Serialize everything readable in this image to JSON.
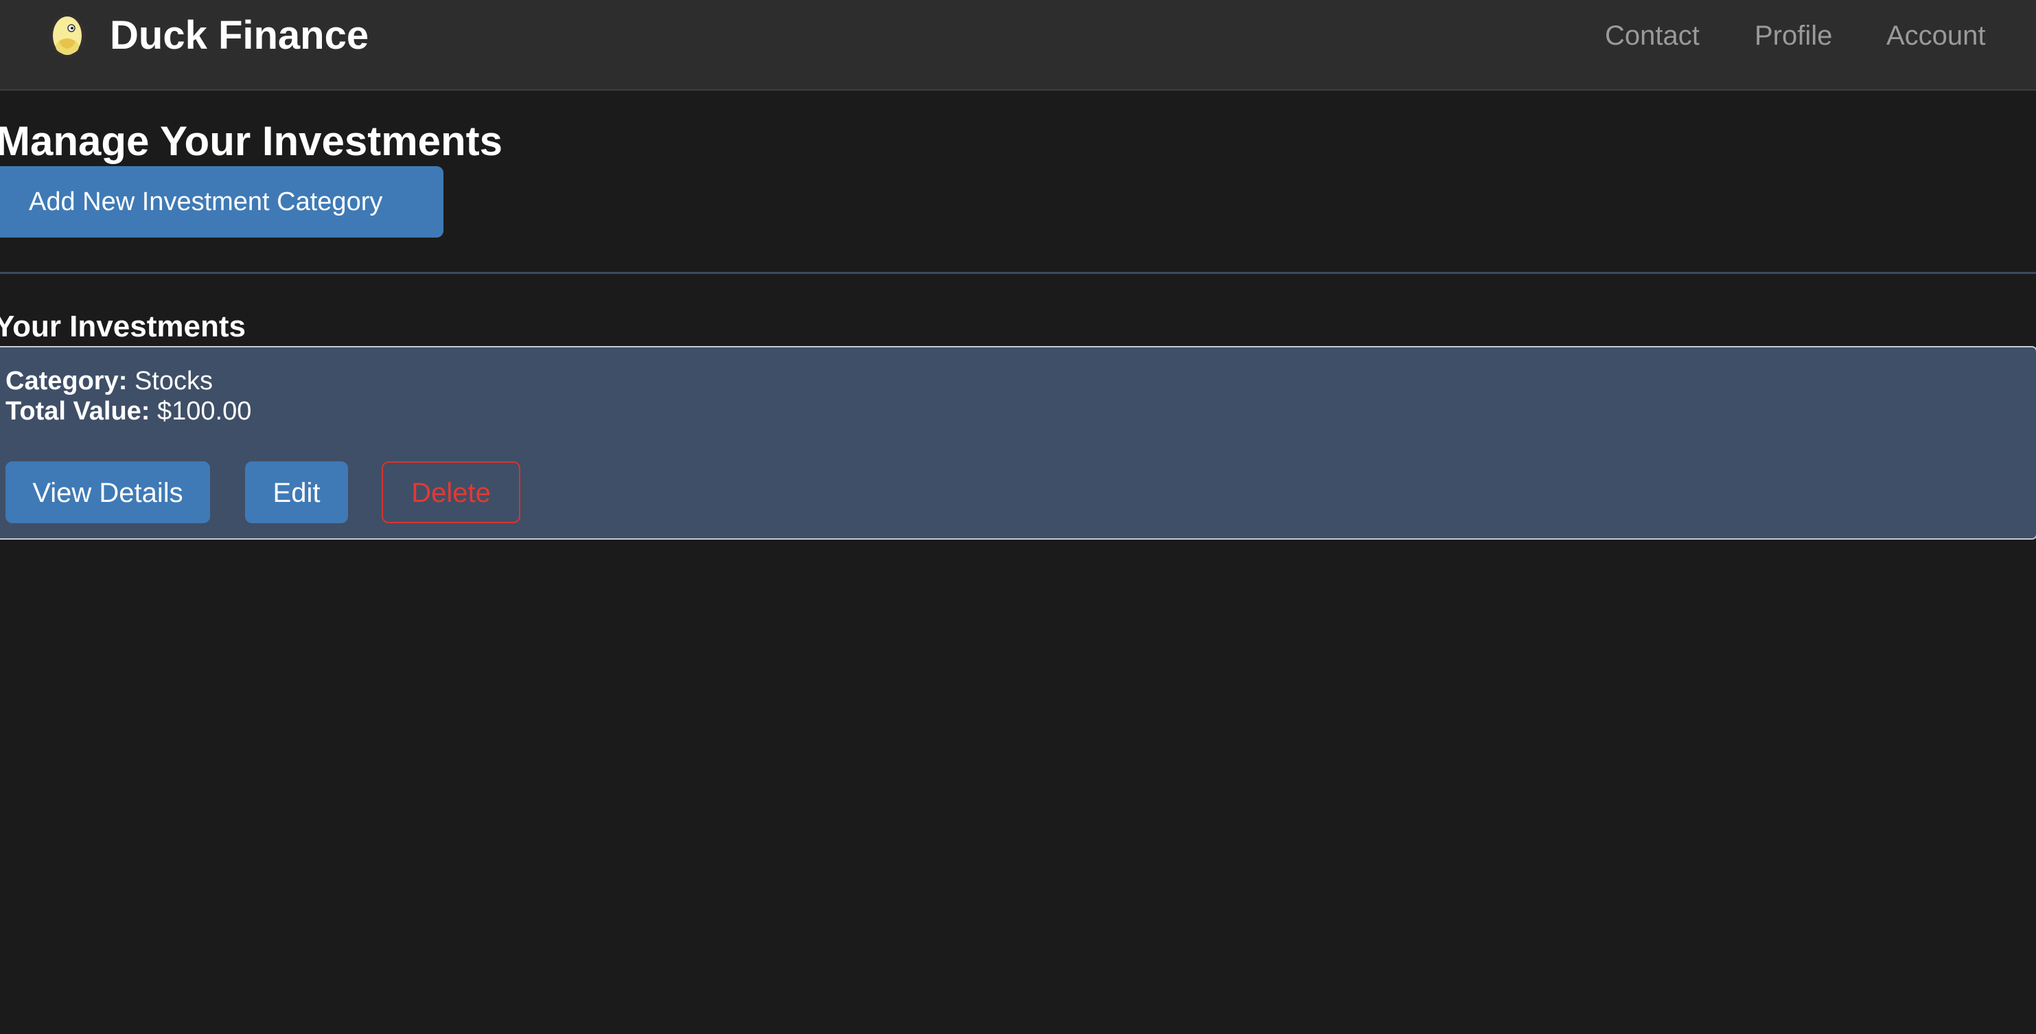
{
  "header": {
    "brand": "Duck Finance",
    "logo_icon": "duck-icon",
    "nav": {
      "contact": "Contact",
      "profile": "Profile",
      "account": "Account"
    }
  },
  "manage": {
    "title": "Manage Your Investments",
    "add_button_label": "Add New Investment Category"
  },
  "investments": {
    "title": "Your Investments",
    "items": [
      {
        "category_label": "Category:",
        "category_value": "Stocks",
        "total_label": "Total Value:",
        "total_value": "$100.00",
        "actions": {
          "view": "View Details",
          "edit": "Edit",
          "delete": "Delete"
        }
      }
    ]
  },
  "colors": {
    "background": "#1b1b1b",
    "header_background": "#2d2d2d",
    "primary_button": "#3f7ab6",
    "card_background": "#3f4f67",
    "danger": "#e23a32",
    "nav_text": "#9a9a9a"
  }
}
